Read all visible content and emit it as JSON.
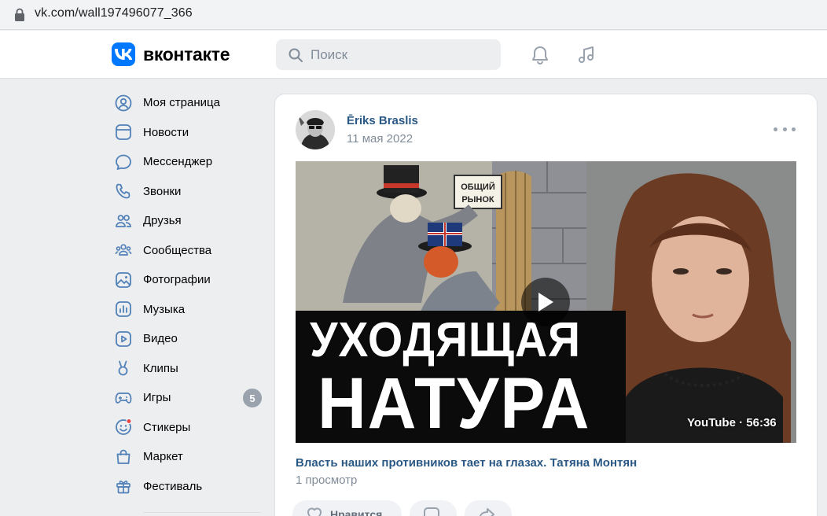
{
  "browser": {
    "url": "vk.com/wall197496077_366"
  },
  "header": {
    "logo_text": "вконтакте",
    "search_placeholder": "Поиск"
  },
  "nav": {
    "items": [
      {
        "label": "Моя страница",
        "icon": "user-circle-icon"
      },
      {
        "label": "Новости",
        "icon": "news-icon"
      },
      {
        "label": "Мессенджер",
        "icon": "chat-bubble-icon"
      },
      {
        "label": "Звонки",
        "icon": "phone-icon"
      },
      {
        "label": "Друзья",
        "icon": "friends-icon"
      },
      {
        "label": "Сообщества",
        "icon": "communities-icon"
      },
      {
        "label": "Фотографии",
        "icon": "photo-icon"
      },
      {
        "label": "Музыка",
        "icon": "music-chart-icon"
      },
      {
        "label": "Видео",
        "icon": "video-icon"
      },
      {
        "label": "Клипы",
        "icon": "clips-icon"
      },
      {
        "label": "Игры",
        "icon": "gamepad-icon",
        "badge": "5"
      },
      {
        "label": "Стикеры",
        "icon": "sticker-icon"
      },
      {
        "label": "Маркет",
        "icon": "market-bag-icon"
      },
      {
        "label": "Фестиваль",
        "icon": "gift-icon"
      }
    ]
  },
  "post": {
    "author": "Ēriks Braslis",
    "date": "11 мая 2022",
    "video": {
      "title_line1": "УХОДЯЩАЯ",
      "title_line2": "НАТУРА",
      "meta": "YouTube · 56:36",
      "sign_text": "ОБЩИЙ РЫНОК"
    },
    "title": "Власть наших противников тает на глазах. Татяна Монтян",
    "views": "1 просмотр",
    "actions": {
      "like_label": "Нравится"
    }
  },
  "colors": {
    "accent": "#0077ff",
    "link": "#2a5885",
    "muted": "#818c99",
    "bg": "#edeef0"
  }
}
